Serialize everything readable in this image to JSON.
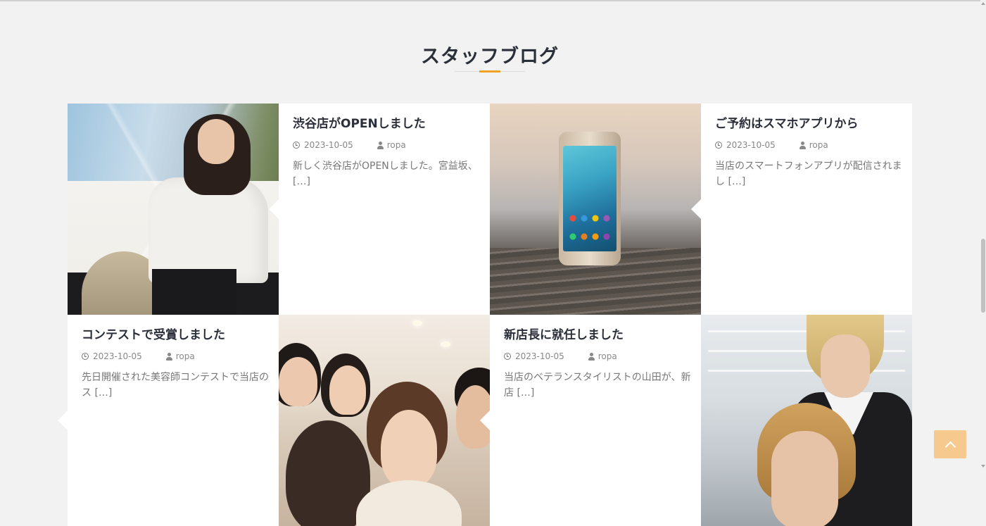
{
  "section": {
    "title": "スタッフブログ",
    "accent_color": "#f0a224"
  },
  "posts": [
    {
      "title": "渋谷店がOPENしました",
      "date": "2023-10-05",
      "author": "ropa",
      "excerpt": "新しく渋谷店がOPENしました。宮益坂、[…]",
      "image_icon": "woman-portrait-image"
    },
    {
      "title": "ご予約はスマホアプリから",
      "date": "2023-10-05",
      "author": "ropa",
      "excerpt": "当店のスマートフォンアプリが配信されまし […]",
      "image_icon": "smartphone-image"
    },
    {
      "title": "コンテストで受賞しました",
      "date": "2023-10-05",
      "author": "ropa",
      "excerpt": "先日開催された美容師コンテストで当店のス […]",
      "image_icon": "group-photo-image"
    },
    {
      "title": "新店長に就任しました",
      "date": "2023-10-05",
      "author": "ropa",
      "excerpt": "当店のベテランスタイリストの山田が、新店 […]",
      "image_icon": "stylist-image"
    }
  ],
  "icons": {
    "date": "clock-icon",
    "author": "user-icon",
    "back_to_top": "chevron-up-icon"
  },
  "colors": {
    "background": "#f2f2f2",
    "card": "#ffffff",
    "title_text": "#2b2f3a",
    "meta_text": "#888888",
    "back_to_top": "#f6c98f"
  }
}
